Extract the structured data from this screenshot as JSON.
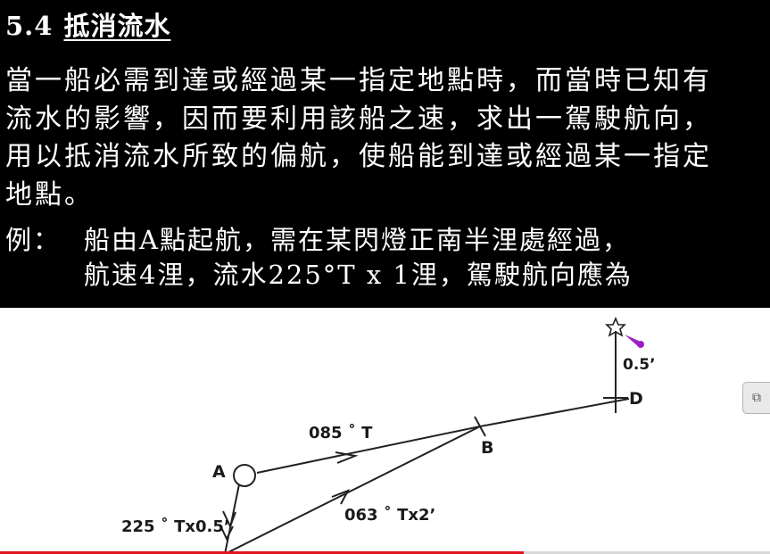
{
  "section": {
    "number": "5.4",
    "title": "抵消流水"
  },
  "paragraph": [
    "當一船必需到達或經過某一指定地點時，而當時已知有",
    "流水的影響，因而要利用該船之速，求出一駕駛航向，",
    "用以抵消流水所致的偏航，使船能到達或經過某一指定",
    "地點。"
  ],
  "example": {
    "label": "例：",
    "line1": "船由A點起航，需在某閃燈正南半浬處經過，",
    "line2": "航速4浬，流水225°T x 1浬，駕駛航向應為"
  },
  "diagram": {
    "label_a": "A",
    "label_b": "B",
    "label_d": "D",
    "label_course": "085 ˚ T",
    "label_resultant": "063 ˚ Tx2’",
    "label_tide": "225 ˚ Tx0.5’",
    "label_distance": "0.5’",
    "light_icon": "star-icon",
    "light_flash_color": "#9b1fc6"
  },
  "side_widget": {
    "icon": "exit-fullscreen-icon"
  },
  "progress": {
    "fraction": 0.68,
    "color": "#e0141e"
  }
}
